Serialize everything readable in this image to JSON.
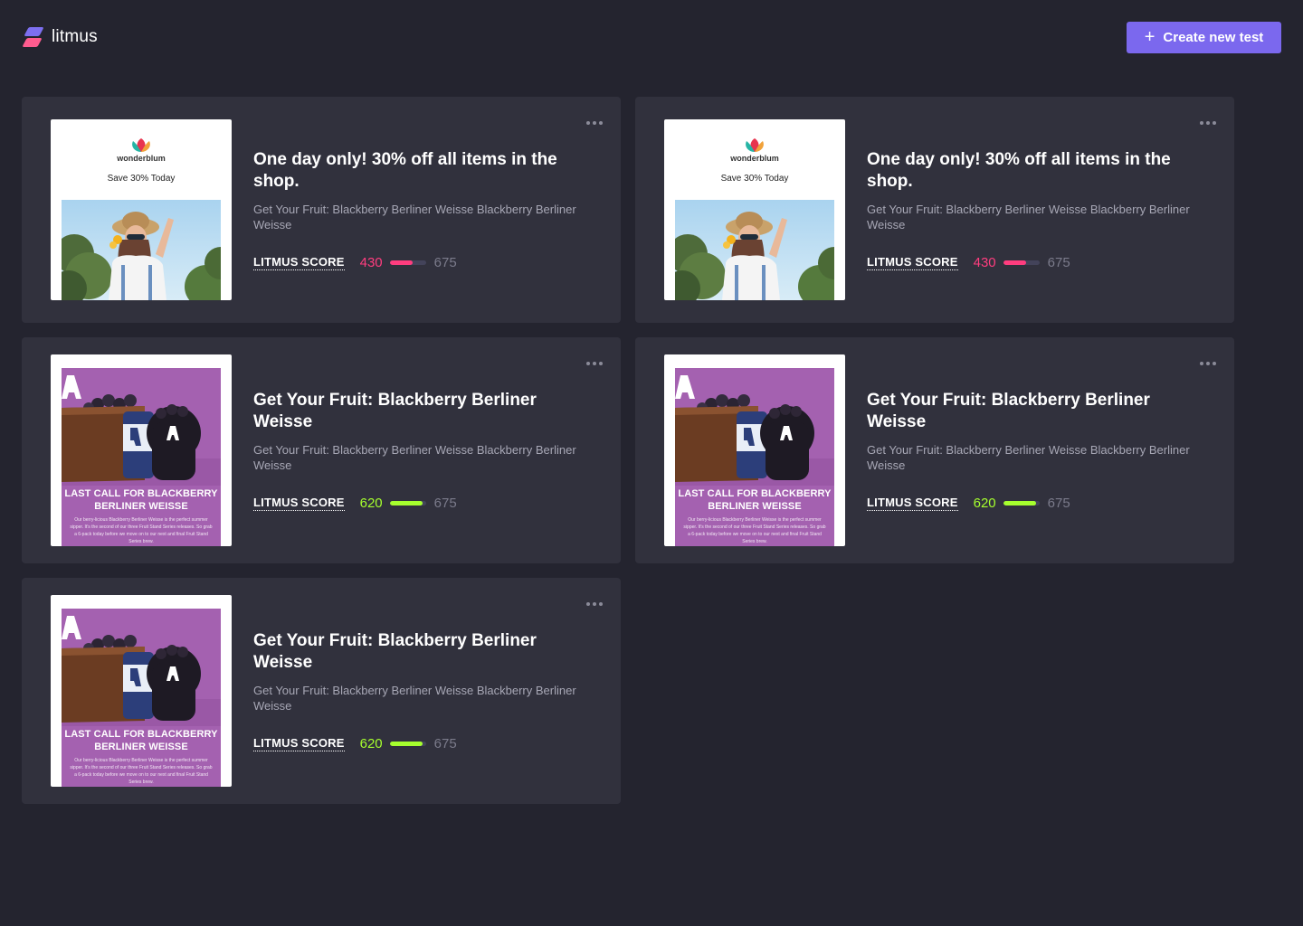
{
  "app": {
    "name": "litmus",
    "create_button": "Create new test"
  },
  "colors": {
    "background": "#24242f",
    "card": "#31313d",
    "accent": "#7b68ee",
    "score_low": "#ff3d7f",
    "score_high": "#a6ff2e"
  },
  "cards": [
    {
      "title": "One day only! 30% off all items in the shop.",
      "subtitle": "Get Your Fruit: Blackberry Berliner Weisse Blackberry Berliner Weisse",
      "score_label": "LITMUS SCORE",
      "score": "430",
      "score_max": "675",
      "score_fraction": 0.64,
      "thumb": {
        "brand": "wonderblum",
        "tagline": "Save 30% Today"
      }
    },
    {
      "title": "One day only! 30% off all items in the shop.",
      "subtitle": "Get Your Fruit: Blackberry Berliner Weisse Blackberry Berliner Weisse",
      "score_label": "LITMUS SCORE",
      "score": "430",
      "score_max": "675",
      "score_fraction": 0.64,
      "thumb": {
        "brand": "wonderblum",
        "tagline": "Save 30% Today"
      }
    },
    {
      "title": "Get Your Fruit: Blackberry Berliner Weisse",
      "subtitle": "Get Your Fruit: Blackberry Berliner Weisse Blackberry Berliner Weisse",
      "score_label": "LITMUS SCORE",
      "score": "620",
      "score_max": "675",
      "score_fraction": 0.92,
      "thumb": {
        "headline": "LAST CALL FOR BLACKBERRY BERLINER WEISSE",
        "body": "Our berry-licious Blackberry Berliner Weisse is the perfect summer sipper. It's the second of our three Fruit Stand Series releases. So grab a 6-pack today before we move on to our next and final Fruit Stand Series brew."
      }
    },
    {
      "title": "Get Your Fruit: Blackberry Berliner Weisse",
      "subtitle": "Get Your Fruit: Blackberry Berliner Weisse Blackberry Berliner Weisse",
      "score_label": "LITMUS SCORE",
      "score": "620",
      "score_max": "675",
      "score_fraction": 0.92,
      "thumb": {
        "headline": "LAST CALL FOR BLACKBERRY BERLINER WEISSE",
        "body": "Our berry-licious Blackberry Berliner Weisse is the perfect summer sipper. It's the second of our three Fruit Stand Series releases. So grab a 6-pack today before we move on to our next and final Fruit Stand Series brew."
      }
    },
    {
      "title": "Get Your Fruit: Blackberry Berliner Weisse",
      "subtitle": "Get Your Fruit: Blackberry Berliner Weisse Blackberry Berliner Weisse",
      "score_label": "LITMUS SCORE",
      "score": "620",
      "score_max": "675",
      "score_fraction": 0.92,
      "thumb": {
        "headline": "LAST CALL FOR BLACKBERRY BERLINER WEISSE",
        "body": "Our berry-licious Blackberry Berliner Weisse is the perfect summer sipper. It's the second of our three Fruit Stand Series releases. So grab a 6-pack today before we move on to our next and final Fruit Stand Series brew."
      }
    }
  ]
}
